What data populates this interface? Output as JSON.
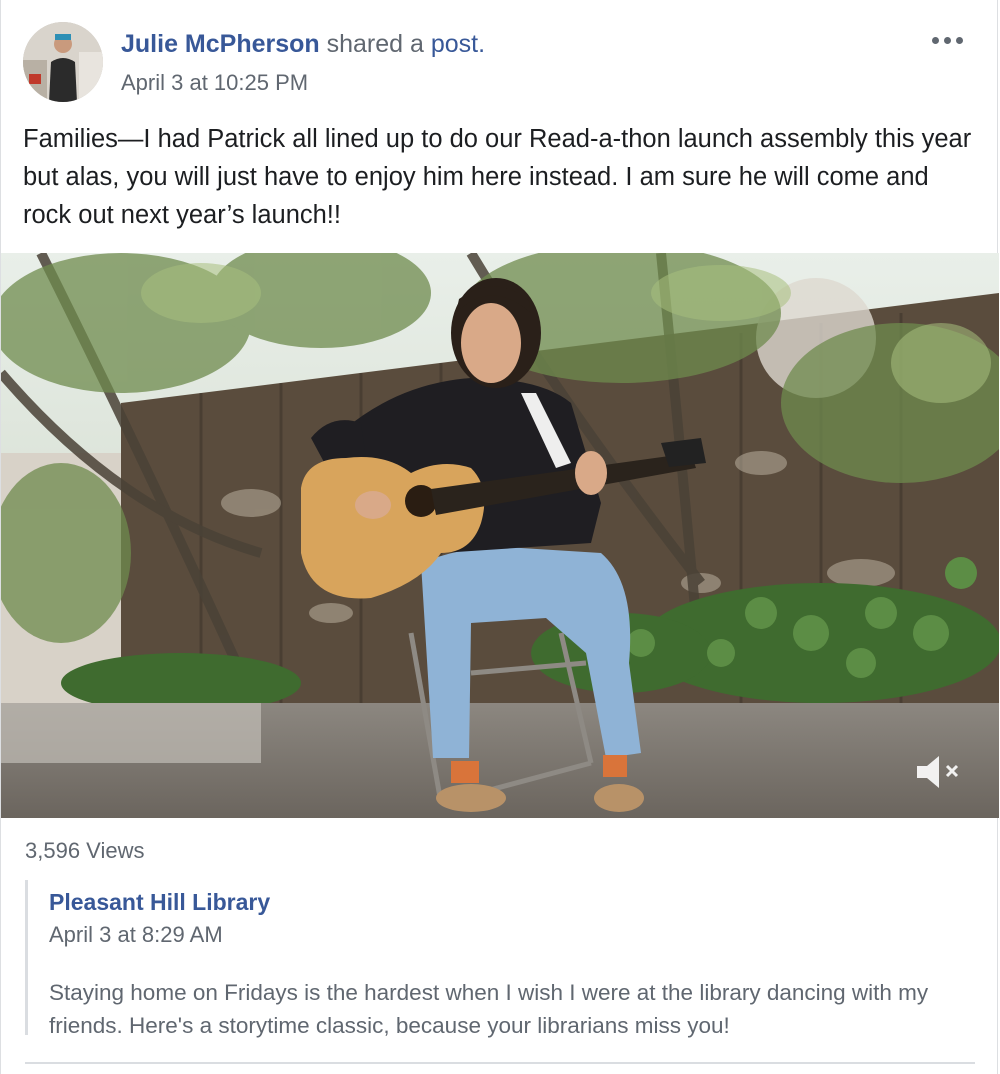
{
  "post": {
    "author": "Julie McPherson",
    "shared_text": "shared a",
    "shared_link": "post.",
    "timestamp": "April 3 at 10:25 PM",
    "body": "Families—I had Patrick all lined up to do our Read-a-thon launch assembly this year but alas, you will just have to enjoy him here instead. I am sure he will come and rock out next year’s launch!!",
    "more_icon": "more-options-icon"
  },
  "video": {
    "content": "man playing acoustic guitar in a garden",
    "mute_icon": "muted-speaker-icon",
    "views": "3,596 Views"
  },
  "shared_post": {
    "page_name": "Pleasant Hill Library",
    "timestamp": "April 3 at 8:29 AM",
    "body": "Staying home on Fridays is the hardest when I wish I were at the library dancing with my friends. Here's a storytime classic, because your librarians miss you!"
  },
  "colors": {
    "link_blue": "#385898",
    "secondary_text": "#606770",
    "primary_text": "#1c1e21",
    "divider": "#dadde1"
  }
}
